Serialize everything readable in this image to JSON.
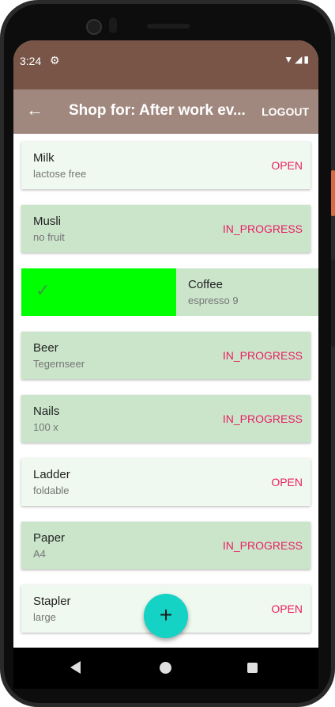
{
  "status_bar": {
    "time": "3:24",
    "settings_icon": "gear-icon",
    "indicators": "▼◢▮"
  },
  "app_bar": {
    "back_icon": "arrow-back-icon",
    "title": "Shop for: After work ev...",
    "logout_label": "LOGOUT"
  },
  "items": [
    {
      "name": "Milk",
      "description": "lactose free",
      "status": "OPEN"
    },
    {
      "name": "Musli",
      "description": "no fruit",
      "status": "IN_PROGRESS"
    },
    {
      "name": "Coffee",
      "description": "espresso 9",
      "status": "",
      "swiped": true
    },
    {
      "name": "Beer",
      "description": "Tegernseer",
      "status": "IN_PROGRESS"
    },
    {
      "name": "Nails",
      "description": "100 x",
      "status": "IN_PROGRESS"
    },
    {
      "name": "Ladder",
      "description": "foldable",
      "status": "OPEN"
    },
    {
      "name": "Paper",
      "description": "A4",
      "status": "IN_PROGRESS"
    },
    {
      "name": "Stapler",
      "description": "large",
      "status": "OPEN"
    }
  ],
  "swipe_action": {
    "icon": "check-icon"
  },
  "fab": {
    "label": "+",
    "icon": "add-icon"
  },
  "nav_bar": {
    "back_icon": "nav-back-icon",
    "home_icon": "nav-home-icon",
    "recents_icon": "nav-recents-icon"
  },
  "colors": {
    "status_bar": "#795548",
    "app_bar": "#a1887f",
    "open_card": "#f0f9f0",
    "in_progress_card": "#cbe5cb",
    "swipe_background": "#00ff00",
    "status_text": "#e91e63",
    "fab": "#14d2c4"
  }
}
